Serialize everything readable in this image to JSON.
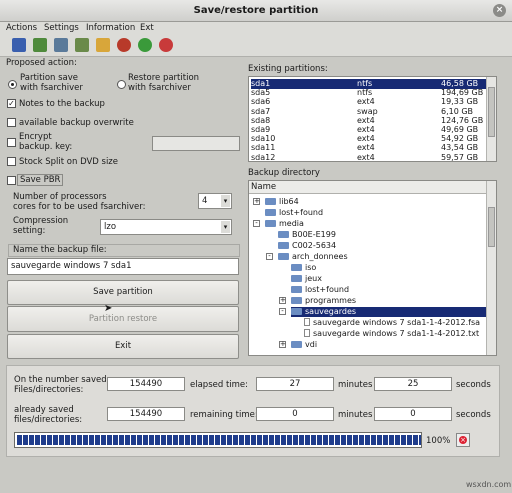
{
  "window": {
    "title": "Save/restore partition"
  },
  "menu": [
    "Actions",
    "Settings",
    "Information",
    "Ext"
  ],
  "toolbar_icons": [
    "save-icon",
    "restore-icon",
    "disk-icon",
    "disk-save-icon",
    "folder-icon",
    "bomb-icon",
    "refresh-icon",
    "help-icon"
  ],
  "proposed_action": {
    "label": "Proposed action:",
    "radio1": "Partition save\nwith fsarchiver",
    "radio2": "Restore partition\nwith fsarchiver",
    "selected": "radio1"
  },
  "options": {
    "notes_label": "Notes to  the backup",
    "notes_checked": true,
    "overwrite_label": "available backup overwrite",
    "encrypt_label": "Encrypt\nbackup. key:",
    "stock_split_label": "Stock Split on DVD size",
    "save_pbr_label": "Save PBR",
    "processors_label": "Number of processors\ncores for to be used fsarchiver:",
    "processors_value": "4",
    "compression_label": "Compression\nsetting:",
    "compression_value": "lzo"
  },
  "backup_name": {
    "label": "Name the backup file:",
    "value": "sauvegarde windows 7 sda1"
  },
  "buttons": {
    "save": "Save partition",
    "restore": "Partition restore",
    "exit": "Exit"
  },
  "partitions": {
    "label": "Existing partitions:",
    "rows": [
      {
        "name": "sda1",
        "fs": "ntfs",
        "size": "46,58 GB",
        "selected": true
      },
      {
        "name": "sda5",
        "fs": "ntfs",
        "size": "194,69 GB"
      },
      {
        "name": "sda6",
        "fs": "ext4",
        "size": "19,33 GB"
      },
      {
        "name": "sda7",
        "fs": "swap",
        "size": "6,10 GB"
      },
      {
        "name": "sda8",
        "fs": "ext4",
        "size": "124,76 GB"
      },
      {
        "name": "sda9",
        "fs": "ext4",
        "size": "49,69 GB"
      },
      {
        "name": "sda10",
        "fs": "ext4",
        "size": "54,92 GB"
      },
      {
        "name": "sda11",
        "fs": "ext4",
        "size": "43,54 GB"
      },
      {
        "name": "sda12",
        "fs": "ext4",
        "size": "59,57 GB"
      }
    ]
  },
  "backup_directory": {
    "label": "Backup directory",
    "column": "Name",
    "items": [
      {
        "name": "lib64",
        "depth": 0,
        "expander": "+",
        "type": "folder"
      },
      {
        "name": "lost+found",
        "depth": 0,
        "expander": "",
        "type": "folder"
      },
      {
        "name": "media",
        "depth": 0,
        "expander": "-",
        "type": "folder"
      },
      {
        "name": "B00E-E199",
        "depth": 1,
        "expander": "",
        "type": "folder"
      },
      {
        "name": "C002-5634",
        "depth": 1,
        "expander": "",
        "type": "folder"
      },
      {
        "name": "arch_donnees",
        "depth": 1,
        "expander": "-",
        "type": "folder"
      },
      {
        "name": "iso",
        "depth": 2,
        "expander": "",
        "type": "folder"
      },
      {
        "name": "jeux",
        "depth": 2,
        "expander": "",
        "type": "folder"
      },
      {
        "name": "lost+found",
        "depth": 2,
        "expander": "",
        "type": "folder"
      },
      {
        "name": "programmes",
        "depth": 2,
        "expander": "+",
        "type": "folder"
      },
      {
        "name": "sauvegardes",
        "depth": 2,
        "expander": "-",
        "type": "folder",
        "selected": true
      },
      {
        "name": "sauvegarde windows 7 sda1-1-4-2012.fsa",
        "depth": 3,
        "expander": "",
        "type": "file"
      },
      {
        "name": "sauvegarde windows 7 sda1-1-4-2012.txt",
        "depth": 3,
        "expander": "",
        "type": "file"
      },
      {
        "name": "vdi",
        "depth": 2,
        "expander": "+",
        "type": "folder"
      }
    ]
  },
  "stats": {
    "saved_label": "On the number saved\nFiles/directories:",
    "saved_value": "154490",
    "already_label": "already saved\nfiles/directories:",
    "already_value": "154490",
    "elapsed_label": "elapsed time:",
    "remaining_label": "remaining time:",
    "elapsed_minutes": "27",
    "elapsed_seconds": "25",
    "remaining_minutes": "0",
    "remaining_seconds": "0",
    "minutes_label": "minutes",
    "seconds_label": "seconds"
  },
  "progress": {
    "value": 1.0,
    "text": "100%"
  },
  "watermark": "wsxdn.com"
}
